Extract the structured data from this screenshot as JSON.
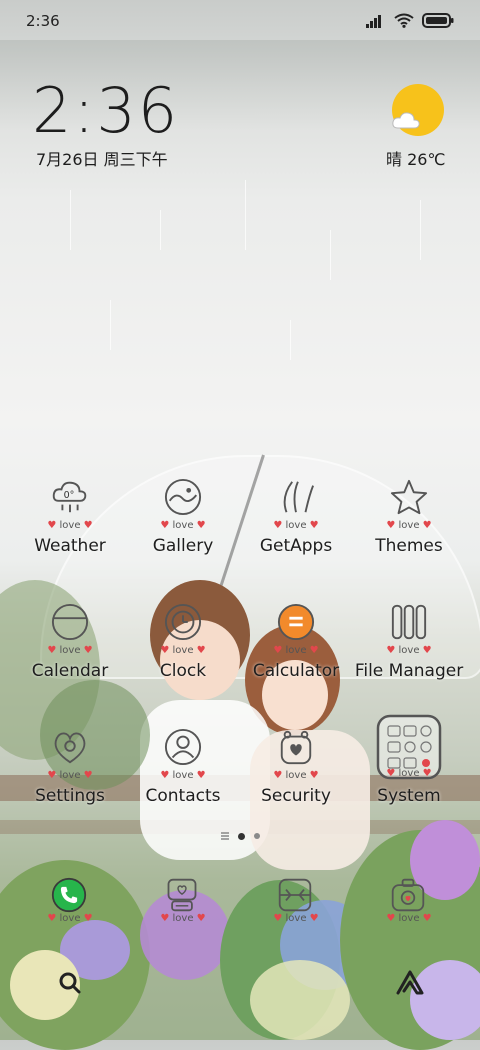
{
  "status_bar": {
    "time": "2:36"
  },
  "clock_widget": {
    "time": "2:36",
    "date": "7月26日 周三下午"
  },
  "weather_widget": {
    "text": "晴 26℃"
  },
  "love_label": "love",
  "apps": [
    {
      "name": "Weather",
      "icon": "weather-icon",
      "icon_text": "0°"
    },
    {
      "name": "Gallery",
      "icon": "gallery-icon"
    },
    {
      "name": "GetApps",
      "icon": "getapps-icon"
    },
    {
      "name": "Themes",
      "icon": "themes-icon"
    },
    {
      "name": "Calendar",
      "icon": "calendar-icon"
    },
    {
      "name": "Clock",
      "icon": "clock-icon"
    },
    {
      "name": "Calculator",
      "icon": "calculator-icon"
    },
    {
      "name": "File Manager",
      "icon": "file-manager-icon"
    },
    {
      "name": "Settings",
      "icon": "settings-icon"
    },
    {
      "name": "Contacts",
      "icon": "contacts-icon"
    },
    {
      "name": "Security",
      "icon": "security-icon"
    },
    {
      "name": "System",
      "icon": "system-folder-icon"
    }
  ],
  "dock": [
    {
      "icon": "phone-icon"
    },
    {
      "icon": "messages-icon"
    },
    {
      "icon": "browser-icon"
    },
    {
      "icon": "camera-icon"
    }
  ],
  "page_indicator": {
    "pages": 3,
    "current": 1
  },
  "colors": {
    "accent_yellow": "#f7c21b",
    "heart_red": "#e2474c",
    "phone_green": "#27b54b",
    "calc_orange": "#f28a2b"
  }
}
